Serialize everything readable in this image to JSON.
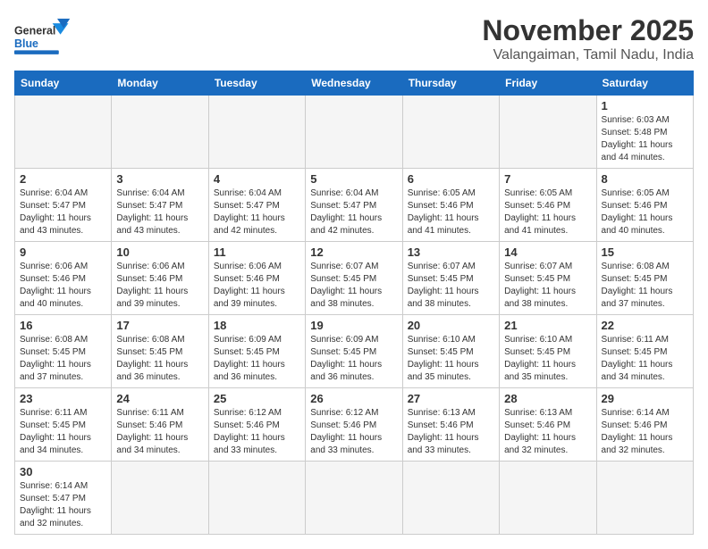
{
  "header": {
    "logo_general": "General",
    "logo_blue": "Blue",
    "month_title": "November 2025",
    "location": "Valangaiman, Tamil Nadu, India"
  },
  "days_of_week": [
    "Sunday",
    "Monday",
    "Tuesday",
    "Wednesday",
    "Thursday",
    "Friday",
    "Saturday"
  ],
  "weeks": [
    [
      {
        "day": "",
        "info": ""
      },
      {
        "day": "",
        "info": ""
      },
      {
        "day": "",
        "info": ""
      },
      {
        "day": "",
        "info": ""
      },
      {
        "day": "",
        "info": ""
      },
      {
        "day": "",
        "info": ""
      },
      {
        "day": "1",
        "info": "Sunrise: 6:03 AM\nSunset: 5:48 PM\nDaylight: 11 hours\nand 44 minutes."
      }
    ],
    [
      {
        "day": "2",
        "info": "Sunrise: 6:04 AM\nSunset: 5:47 PM\nDaylight: 11 hours\nand 43 minutes."
      },
      {
        "day": "3",
        "info": "Sunrise: 6:04 AM\nSunset: 5:47 PM\nDaylight: 11 hours\nand 43 minutes."
      },
      {
        "day": "4",
        "info": "Sunrise: 6:04 AM\nSunset: 5:47 PM\nDaylight: 11 hours\nand 42 minutes."
      },
      {
        "day": "5",
        "info": "Sunrise: 6:04 AM\nSunset: 5:47 PM\nDaylight: 11 hours\nand 42 minutes."
      },
      {
        "day": "6",
        "info": "Sunrise: 6:05 AM\nSunset: 5:46 PM\nDaylight: 11 hours\nand 41 minutes."
      },
      {
        "day": "7",
        "info": "Sunrise: 6:05 AM\nSunset: 5:46 PM\nDaylight: 11 hours\nand 41 minutes."
      },
      {
        "day": "8",
        "info": "Sunrise: 6:05 AM\nSunset: 5:46 PM\nDaylight: 11 hours\nand 40 minutes."
      }
    ],
    [
      {
        "day": "9",
        "info": "Sunrise: 6:06 AM\nSunset: 5:46 PM\nDaylight: 11 hours\nand 40 minutes."
      },
      {
        "day": "10",
        "info": "Sunrise: 6:06 AM\nSunset: 5:46 PM\nDaylight: 11 hours\nand 39 minutes."
      },
      {
        "day": "11",
        "info": "Sunrise: 6:06 AM\nSunset: 5:46 PM\nDaylight: 11 hours\nand 39 minutes."
      },
      {
        "day": "12",
        "info": "Sunrise: 6:07 AM\nSunset: 5:45 PM\nDaylight: 11 hours\nand 38 minutes."
      },
      {
        "day": "13",
        "info": "Sunrise: 6:07 AM\nSunset: 5:45 PM\nDaylight: 11 hours\nand 38 minutes."
      },
      {
        "day": "14",
        "info": "Sunrise: 6:07 AM\nSunset: 5:45 PM\nDaylight: 11 hours\nand 38 minutes."
      },
      {
        "day": "15",
        "info": "Sunrise: 6:08 AM\nSunset: 5:45 PM\nDaylight: 11 hours\nand 37 minutes."
      }
    ],
    [
      {
        "day": "16",
        "info": "Sunrise: 6:08 AM\nSunset: 5:45 PM\nDaylight: 11 hours\nand 37 minutes."
      },
      {
        "day": "17",
        "info": "Sunrise: 6:08 AM\nSunset: 5:45 PM\nDaylight: 11 hours\nand 36 minutes."
      },
      {
        "day": "18",
        "info": "Sunrise: 6:09 AM\nSunset: 5:45 PM\nDaylight: 11 hours\nand 36 minutes."
      },
      {
        "day": "19",
        "info": "Sunrise: 6:09 AM\nSunset: 5:45 PM\nDaylight: 11 hours\nand 36 minutes."
      },
      {
        "day": "20",
        "info": "Sunrise: 6:10 AM\nSunset: 5:45 PM\nDaylight: 11 hours\nand 35 minutes."
      },
      {
        "day": "21",
        "info": "Sunrise: 6:10 AM\nSunset: 5:45 PM\nDaylight: 11 hours\nand 35 minutes."
      },
      {
        "day": "22",
        "info": "Sunrise: 6:11 AM\nSunset: 5:45 PM\nDaylight: 11 hours\nand 34 minutes."
      }
    ],
    [
      {
        "day": "23",
        "info": "Sunrise: 6:11 AM\nSunset: 5:45 PM\nDaylight: 11 hours\nand 34 minutes."
      },
      {
        "day": "24",
        "info": "Sunrise: 6:11 AM\nSunset: 5:46 PM\nDaylight: 11 hours\nand 34 minutes."
      },
      {
        "day": "25",
        "info": "Sunrise: 6:12 AM\nSunset: 5:46 PM\nDaylight: 11 hours\nand 33 minutes."
      },
      {
        "day": "26",
        "info": "Sunrise: 6:12 AM\nSunset: 5:46 PM\nDaylight: 11 hours\nand 33 minutes."
      },
      {
        "day": "27",
        "info": "Sunrise: 6:13 AM\nSunset: 5:46 PM\nDaylight: 11 hours\nand 33 minutes."
      },
      {
        "day": "28",
        "info": "Sunrise: 6:13 AM\nSunset: 5:46 PM\nDaylight: 11 hours\nand 32 minutes."
      },
      {
        "day": "29",
        "info": "Sunrise: 6:14 AM\nSunset: 5:46 PM\nDaylight: 11 hours\nand 32 minutes."
      }
    ],
    [
      {
        "day": "30",
        "info": "Sunrise: 6:14 AM\nSunset: 5:47 PM\nDaylight: 11 hours\nand 32 minutes."
      },
      {
        "day": "",
        "info": ""
      },
      {
        "day": "",
        "info": ""
      },
      {
        "day": "",
        "info": ""
      },
      {
        "day": "",
        "info": ""
      },
      {
        "day": "",
        "info": ""
      },
      {
        "day": "",
        "info": ""
      }
    ]
  ]
}
